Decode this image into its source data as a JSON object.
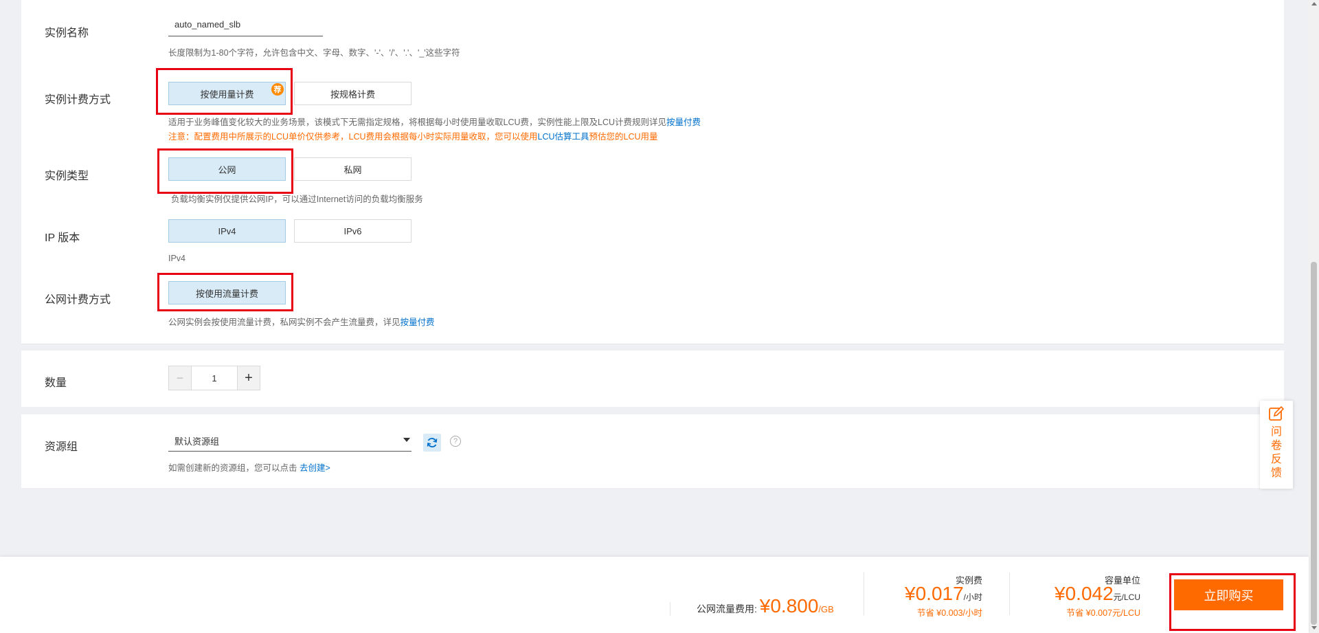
{
  "form": {
    "instance_name": {
      "label": "实例名称",
      "value": "auto_named_slb",
      "help": "长度限制为1-80个字符，允许包含中文、字母、数字、'-'、'/'、'.'、'_'这些字符"
    },
    "billing": {
      "label": "实例计费方式",
      "options": [
        "按使用量计费",
        "按规格计费"
      ],
      "selected_badge": "荐",
      "help_prefix": "适用于业务峰值变化较大的业务场景，该模式下无需指定规格，将根据每小时使用量收取LCU费，实例性能上限及LCU计费规则详见",
      "help_link": "按量付费",
      "warn_prefix": "注意：配置费用中所展示的LCU单价仅供参考，LCU费用会根据每小时实际用量收取，您可以使用",
      "warn_link": "LCU估算工具",
      "warn_suffix": "预估您的LCU用量"
    },
    "instance_type": {
      "label": "实例类型",
      "options": [
        "公网",
        "私网"
      ],
      "help": "负载均衡实例仅提供公网IP，可以通过Internet访问的负载均衡服务"
    },
    "ip_version": {
      "label": "IP 版本",
      "options": [
        "IPv4",
        "IPv6"
      ],
      "help": "IPv4"
    },
    "network_billing": {
      "label": "公网计费方式",
      "option": "按使用流量计费",
      "help_prefix": "公网实例会按使用流量计费，私网实例不会产生流量费，详见",
      "help_link": "按量付费"
    },
    "quantity": {
      "label": "数量",
      "minus": "−",
      "value": "1",
      "plus": "+"
    },
    "resource_group": {
      "label": "资源组",
      "value": "默认资源组",
      "help_prefix": "如需创建新的资源组，您可以点击 ",
      "help_link": "去创建>"
    }
  },
  "feedback": {
    "chars": [
      "问",
      "卷",
      "反",
      "馈"
    ],
    "icon": "edit-icon"
  },
  "footer": {
    "traffic_label": "公网流量费用:",
    "traffic_price": "¥0.800",
    "traffic_unit": "/GB",
    "instance_fee_title": "实例费",
    "instance_fee_price": "¥0.017",
    "instance_fee_unit": "/小时",
    "instance_fee_save": "节省 ¥0.003/小时",
    "lcu_title": "容量单位",
    "lcu_price": "¥0.042",
    "lcu_unit": "元/LCU",
    "lcu_save": "节省 ¥0.007元/LCU",
    "buy_button": "立即购买"
  },
  "colors": {
    "accent": "#ff6a00",
    "link": "#0070cc",
    "highlight_box": "#e60012",
    "selected_bg": "#d9ebf7"
  }
}
